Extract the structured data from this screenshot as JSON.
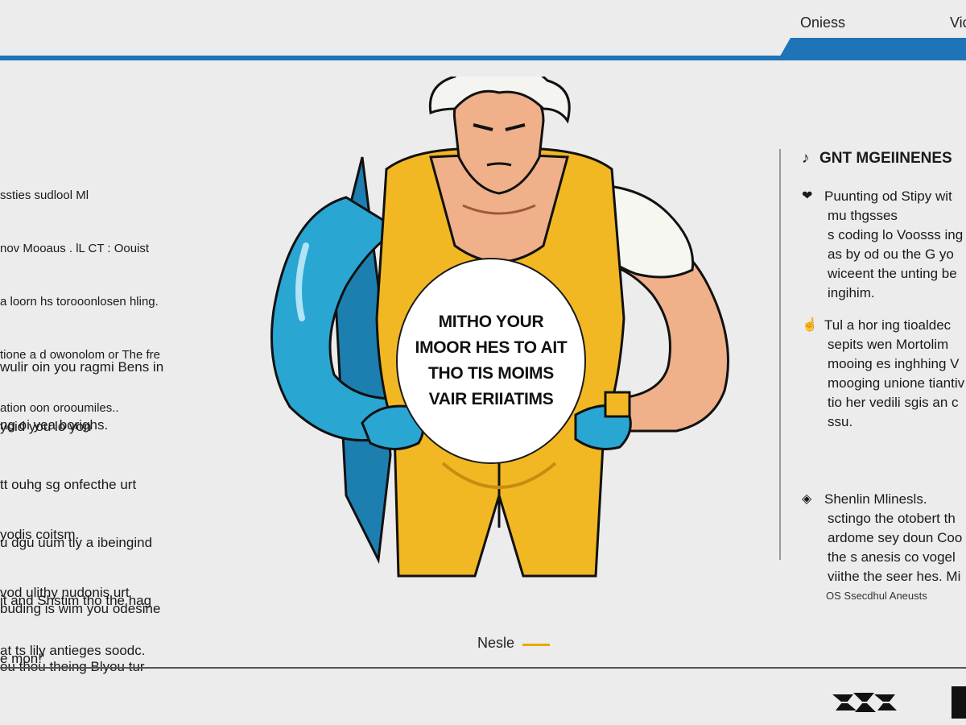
{
  "nav": {
    "links": [
      "Oniess",
      "Vic"
    ]
  },
  "left": {
    "block1": [
      "ssties sudlool Ml",
      "nov Mooaus . lL CT : Oouist",
      "a loorn hs torooonlosen hling.",
      "tione a d owonolom or The fre",
      "ation oon orooumiles.."
    ],
    "block2": [
      "wulir oin you ragmi Bens in",
      "ng oi yea borighs."
    ],
    "block3": [
      "yoid you lo yon",
      "tt ouhg sg onfecthe urt",
      "u dgu uum tly a ibeingind",
      "it and Shstim tho the hag",
      "e mon!'"
    ],
    "block4": [
      "yodis coitsm.",
      "vod ulithy nudonis urt",
      "at ts lily antieges soodc."
    ],
    "block5": [
      "buding is wim you odesine",
      "ou thou theing Blyou tur"
    ]
  },
  "bubble": {
    "lines": [
      "MITHO YOUR",
      "IMOOR HES TO AIT",
      "THO TIS MOIMS",
      "VAIR ERIIATIMS"
    ]
  },
  "right": {
    "heading": "GNT MGEIINENES",
    "items": [
      {
        "icon": "heart-icon",
        "lines": [
          "Puunting od Stipy wit",
          "mu thgsses",
          "s coding lo Voosss ing n",
          "as by od ou the G yo",
          "wiceent the unting be",
          "ingihim."
        ]
      },
      {
        "icon": "pointer-icon",
        "lines": [
          "Tul a hor ing tioaldec",
          "sepits wen Mortolim",
          "mooing es inghhing V",
          "mooging unione tiantiv",
          "tio her vedili sgis an c",
          "ssu."
        ]
      },
      {
        "icon": "tag-icon",
        "lines": [
          "Shenlin Mlinesls.",
          "sctingo the otobert th",
          "ardome sey doun Coo",
          "the s anesis co vogel",
          "viithe the seer hes. Mi"
        ]
      }
    ],
    "footer": "OS Ssecdhul Aneusts"
  },
  "bottom": {
    "next_label": "Nesle"
  },
  "colors": {
    "accent_blue": "#1f73b7",
    "suit_yellow": "#f2b823",
    "suit_blue": "#2aa6d3",
    "skin": "#efb08a",
    "underline": "#e8a800"
  }
}
